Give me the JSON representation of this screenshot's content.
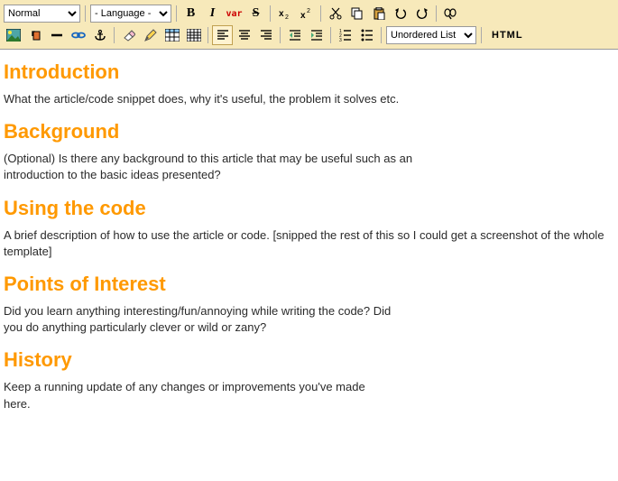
{
  "toolbar": {
    "style_select": "Normal",
    "language_select": "- Language -",
    "list_select": "Unordered List",
    "html_button": "HTML"
  },
  "sections": [
    {
      "heading": "Introduction",
      "body": "What the article/code snippet does, why it's useful, the problem it solves etc."
    },
    {
      "heading": "Background",
      "body": "(Optional) Is there any background to this article that may be useful such as an introduction to the basic ideas presented?"
    },
    {
      "heading": "Using the code",
      "body": "A brief description of how to use the article or code.  [snipped the rest of this so I could get a screenshot of the whole template]"
    },
    {
      "heading": "Points of Interest",
      "body": "Did you learn anything interesting/fun/annoying while writing the code? Did you do anything particularly clever or wild or zany?"
    },
    {
      "heading": "History",
      "body": "Keep a running update of any changes or improvements you've made here."
    }
  ]
}
